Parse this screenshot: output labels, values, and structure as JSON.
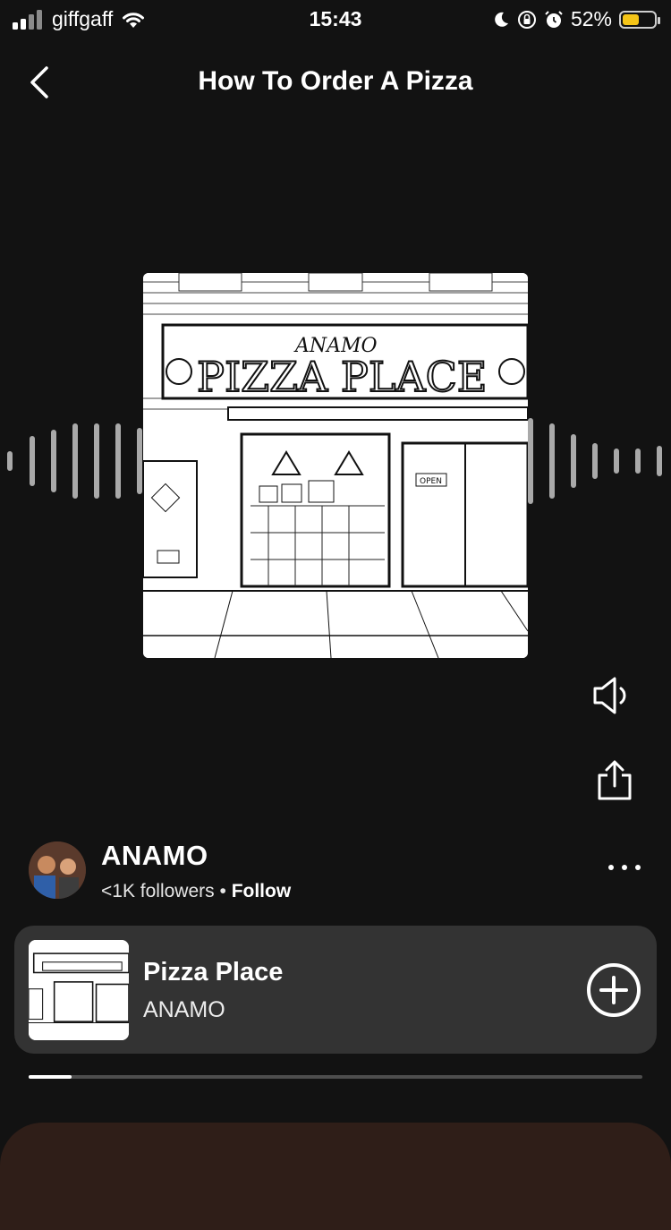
{
  "status_bar": {
    "carrier": "giffgaff",
    "time": "15:43",
    "battery": "52%",
    "battery_level": 0.52,
    "battery_color": "#f5c518",
    "icons": [
      "signal-icon",
      "wifi-icon",
      "moon-icon",
      "rotation-lock-icon",
      "alarm-icon",
      "battery-icon"
    ]
  },
  "header": {
    "title": "How To Order A Pizza",
    "back_icon": "chevron-left-icon"
  },
  "cover": {
    "alt": "Pizza Place album art",
    "sign_small": "ANAMO",
    "sign_big": "PIZZA PLACE",
    "door_sign": "OPEN"
  },
  "side_actions": {
    "volume_icon": "volume-icon",
    "share_icon": "share-icon"
  },
  "artist": {
    "name": "ANAMO",
    "followers": "<1K followers",
    "separator": " • ",
    "follow_label": "Follow",
    "more_icon": "more-horizontal-icon"
  },
  "track": {
    "title": "Pizza Place",
    "artist": "ANAMO",
    "add_icon": "plus-circle-icon"
  },
  "playback": {
    "progress": 0.07
  },
  "colors": {
    "background": "#121212",
    "card": "#333333",
    "bottom_sheet": "#2f1e18",
    "waveform": "#a9a9a9"
  }
}
